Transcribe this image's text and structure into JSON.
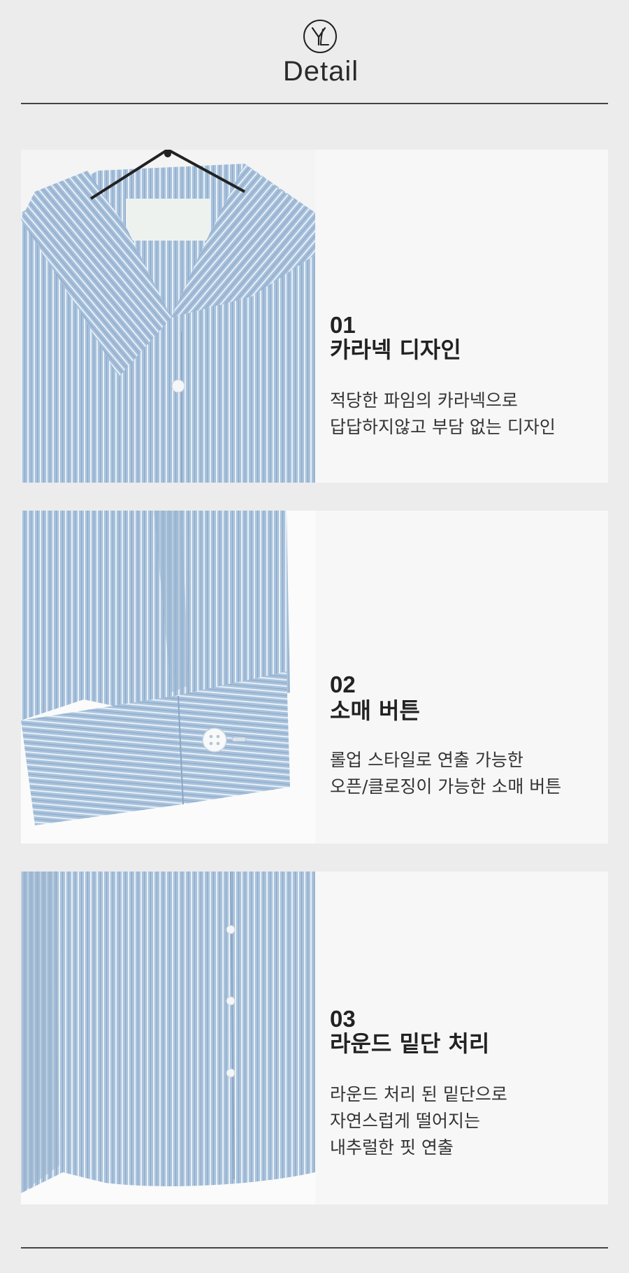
{
  "header": {
    "title": "Detail",
    "logo_icon": "yl-monogram-logo"
  },
  "colors": {
    "background": "#ececec",
    "panel": "#f7f7f8",
    "fabric_base": "#a9c2dc",
    "fabric_stripe": "#e8f0f8",
    "fabric_dark_stripe": "#8aa7c6",
    "rule": "#444444"
  },
  "sections": [
    {
      "number": "01",
      "heading": "카라넥 디자인",
      "lines": [
        "적당한 파임의 카라넥으로",
        "답답하지않고 부담 없는 디자인"
      ],
      "photo": "shirt-collar-photo"
    },
    {
      "number": "02",
      "heading": "소매 버튼",
      "lines": [
        "롤업 스타일로 연출 가능한",
        "오픈/클로징이 가능한 소매 버튼"
      ],
      "photo": "shirt-cuff-photo"
    },
    {
      "number": "03",
      "heading": "라운드 밑단 처리",
      "lines": [
        "라운드 처리 된 밑단으로",
        "자연스럽게 떨어지는",
        "내추럴한 핏 연출"
      ],
      "photo": "shirt-hem-photo"
    }
  ]
}
